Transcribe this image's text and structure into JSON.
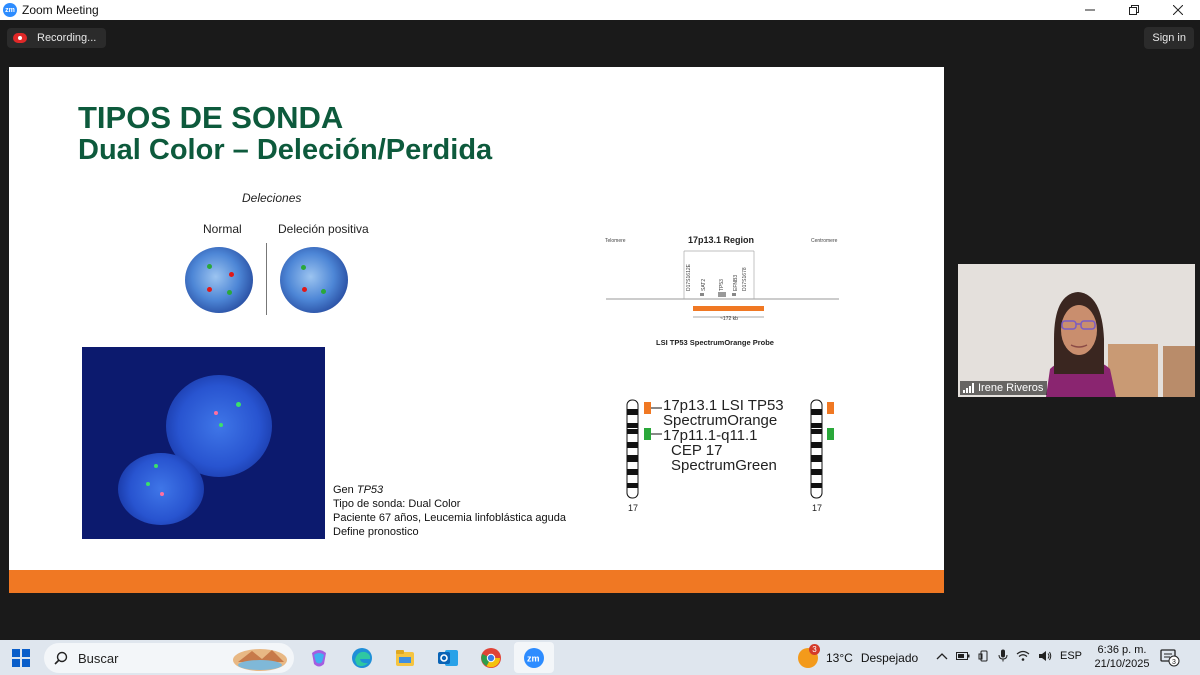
{
  "window": {
    "title": "Zoom Meeting",
    "controls": {
      "minimize": "—",
      "restore": "❐",
      "close": "✕"
    }
  },
  "toolbar": {
    "recording_label": "Recording...",
    "signin_label": "Sign in"
  },
  "slide": {
    "title_line1": "TIPOS DE SONDA",
    "title_line2": "Dual Color – Deleción/Perdida",
    "deletion_caption": "Deleciones",
    "label_normal": "Normal",
    "label_deletion": "Deleción positiva",
    "info": {
      "gene_prefix": "Gen ",
      "gene_name": "TP53",
      "probe_type": "Tipo de sonda: Dual Color",
      "patient": "Paciente 67 años, Leucemia linfoblástica aguda",
      "note": "Define pronostico"
    },
    "probe_diagram": {
      "telomere": "Telomere",
      "region": "17p13.1 Region",
      "centromere": "Centromere",
      "markers": [
        "D17S1612E",
        "SAT2",
        "TP53",
        "EFNB3",
        "D17S1678"
      ],
      "size": "~172 kb",
      "probe_name": "LSI TP53 SpectrumOrange Probe"
    },
    "chromosome_legend": {
      "orange_line1": "17p13.1 LSI TP53",
      "orange_line2": "SpectrumOrange",
      "green_line1": "17p11.1-q11.1",
      "green_line2": "CEP 17",
      "green_line3": "SpectrumGreen",
      "chrom_left": "17",
      "chrom_right": "17"
    },
    "colors": {
      "title_green": "#0d5a3c",
      "accent_orange": "#f07823",
      "probe_green": "#2aa83a"
    }
  },
  "participant": {
    "name": "Irene Riveros"
  },
  "taskbar": {
    "search_placeholder": "Buscar",
    "weather_badge": "3",
    "temperature": "13°C",
    "condition": "Despejado",
    "language": "ESP",
    "time": "6:36 p. m.",
    "date": "21/10/2025",
    "notification_count": "3"
  }
}
